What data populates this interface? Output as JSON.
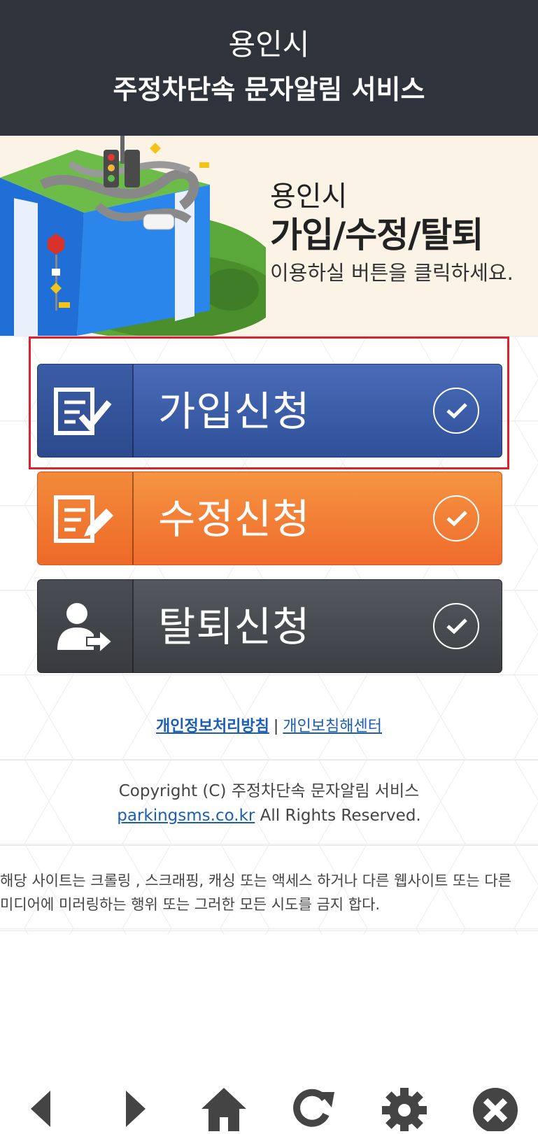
{
  "header": {
    "line1": "용인시",
    "line2": "주정차단속 문자알림 서비스"
  },
  "banner": {
    "line1": "용인시",
    "line2": "가입/수정/탈퇴",
    "line3": "이용하실 버튼을 클릭하세요."
  },
  "buttons": {
    "join": {
      "label": "가입신청",
      "icon": "form-check-icon"
    },
    "edit": {
      "label": "수정신청",
      "icon": "form-edit-icon"
    },
    "quit": {
      "label": "탈퇴신청",
      "icon": "user-exit-icon"
    }
  },
  "links": {
    "privacy": "개인정보처리방침",
    "separator": "|",
    "report": "개인보침해센터"
  },
  "copyright": {
    "line1": "Copyright (C) 주정차단속 문자알림 서비스",
    "site": "parkingsms.co.kr",
    "rights": " All Rights Reserved."
  },
  "notice": {
    "line1": "해당 사이트는 크롤링 , 스크래핑, 캐싱 또는 액세스 하거나 다른 웹사이트 또는 다른",
    "line2": "미디어에 미러링하는 행위 또는 그러한 모든 시도를 금지 합다."
  },
  "toolbar": {
    "items": [
      "back-icon",
      "forward-icon",
      "home-icon",
      "refresh-icon",
      "settings-icon",
      "close-icon"
    ]
  },
  "colors": {
    "header_bg": "#2f333b",
    "join": "#3b5ca6",
    "edit": "#f07a30",
    "quit": "#45484d",
    "highlight": "#e0202c",
    "link": "#1a5fb4"
  }
}
